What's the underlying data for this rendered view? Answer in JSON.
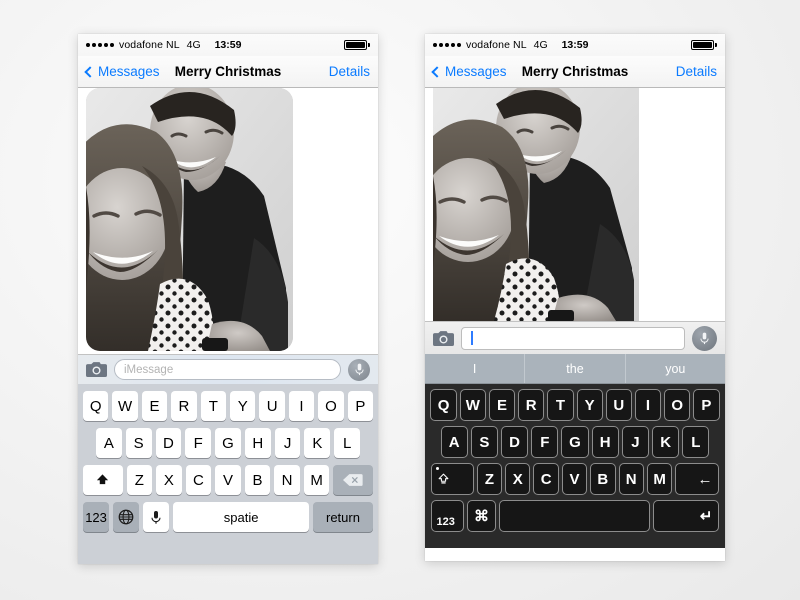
{
  "statusbar": {
    "signal_bars": 5,
    "carrier": "vodafone NL",
    "network": "4G",
    "time": "13:59",
    "battery_icon": "battery-full-icon"
  },
  "navbar": {
    "back_label": "Messages",
    "back_icon": "chevron-left-icon",
    "title": "Merry Christmas",
    "details_label": "Details",
    "accent_color": "#0b7bff"
  },
  "conversation": {
    "attachment": {
      "type": "photo",
      "description": "black and white photo of two smiling people",
      "alt": "Merry Christmas photo attachment"
    }
  },
  "input_left": {
    "camera_icon": "camera-icon",
    "placeholder": "iMessage",
    "value": "",
    "mic_icon": "microphone-icon"
  },
  "input_right": {
    "camera_icon": "camera-icon",
    "placeholder": "",
    "value": "",
    "focused": true,
    "caret_color": "#2d7bff",
    "mic_icon": "microphone-icon"
  },
  "predictive": {
    "suggestions": [
      "I",
      "the",
      "you"
    ],
    "background_color": "#aab3bb"
  },
  "keyboard_left": {
    "theme": "light",
    "background_color": "#ccd0d6",
    "row1": [
      "Q",
      "W",
      "E",
      "R",
      "T",
      "Y",
      "U",
      "I",
      "O",
      "P"
    ],
    "row2": [
      "A",
      "S",
      "D",
      "F",
      "G",
      "H",
      "J",
      "K",
      "L"
    ],
    "row3": [
      "Z",
      "X",
      "C",
      "V",
      "B",
      "N",
      "M"
    ],
    "shift_icon": "shift-arrow-icon",
    "backspace_icon": "backspace-delete-icon",
    "numbers_label": "123",
    "globe_icon": "globe-icon",
    "dictation_icon": "microphone-icon",
    "space_label": "spatie",
    "return_label": "return"
  },
  "keyboard_right": {
    "theme": "dark",
    "background_color": "#2a2a2a",
    "row1": [
      "Q",
      "W",
      "E",
      "R",
      "T",
      "Y",
      "U",
      "I",
      "O",
      "P"
    ],
    "row2": [
      "A",
      "S",
      "D",
      "F",
      "G",
      "H",
      "J",
      "K",
      "L"
    ],
    "row3": [
      "Z",
      "X",
      "C",
      "V",
      "B",
      "N",
      "M"
    ],
    "shift_icon": "shift-arrow-icon",
    "backspace_label": "←",
    "numbers_label": "123",
    "command_label": "⌘",
    "space_label": "",
    "return_label": "↵"
  }
}
